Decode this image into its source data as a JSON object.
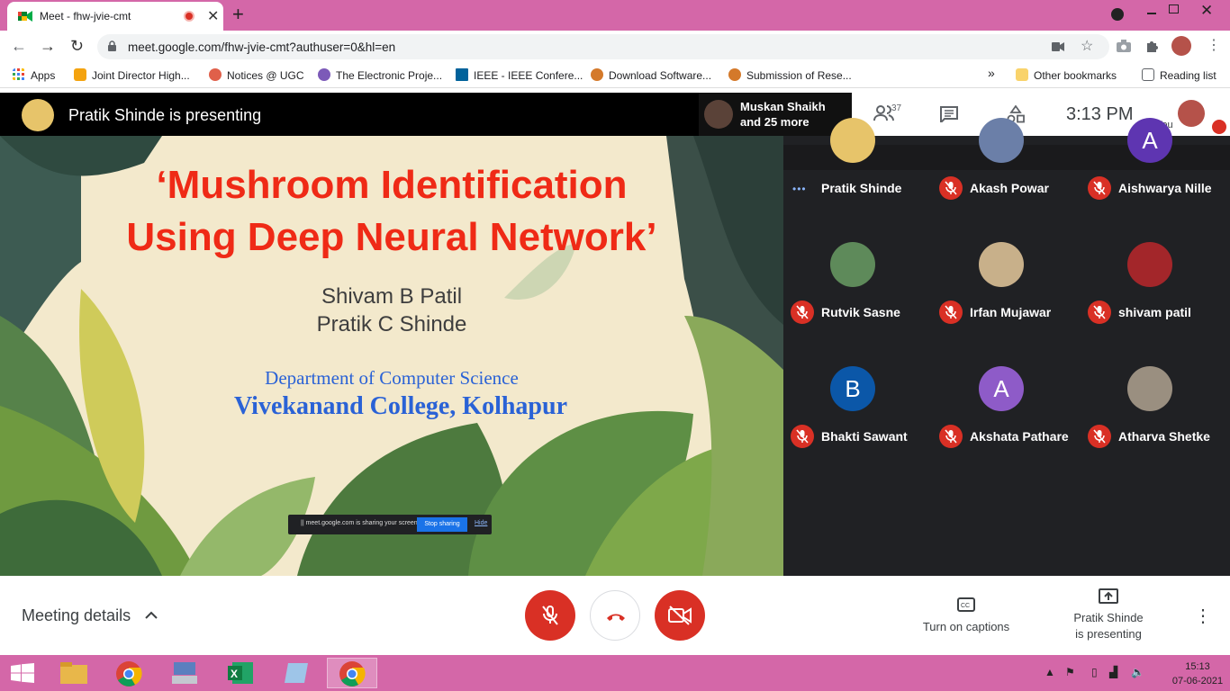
{
  "browser": {
    "tab_title": "Meet - fhw-jvie-cmt",
    "tab_close": "✕",
    "new_tab": "+",
    "url": "meet.google.com/fhw-jvie-cmt?authuser=0&hl=en"
  },
  "bookmarks": {
    "items": [
      {
        "label": "Apps",
        "color": "#4285f4"
      },
      {
        "label": "Joint Director High...",
        "color": "#f4a30f"
      },
      {
        "label": "Notices @ UGC",
        "color": "#e0604a"
      },
      {
        "label": "The Electronic Proje...",
        "color": "#7c5ab8"
      },
      {
        "label": "IEEE - IEEE Confere...",
        "color": "#00629b"
      },
      {
        "label": "Download Software...",
        "color": "#d4792a"
      },
      {
        "label": "Submission of Rese...",
        "color": "#d4792a"
      }
    ],
    "more": "»",
    "other": "Other bookmarks",
    "reading_list": "Reading list"
  },
  "meet": {
    "presenting_banner": "Pratik Shinde is presenting",
    "muskan": {
      "name": "Muskan Shaikh",
      "more": "and 25 more"
    },
    "participant_count": "37",
    "time": "3:13  PM",
    "you_label": "You"
  },
  "slide": {
    "title_line1": "‘Mushroom Identification",
    "title_line2": "Using Deep Neural Network’",
    "author1": "Shivam B Patil",
    "author2": "Pratik C Shinde",
    "department": "Department of Computer Science",
    "college": "Vivekanand College, Kolhapur",
    "share_text": "||  meet.google.com is sharing your screen.",
    "stop_sharing": "Stop sharing",
    "hide": "Hide"
  },
  "participants": [
    {
      "name": "Pratik Shinde",
      "initial": "",
      "color": "#e7c46a",
      "muted": false
    },
    {
      "name": "Akash Powar",
      "initial": "",
      "color": "#6b7fa8",
      "muted": true
    },
    {
      "name": "Aishwarya Nille",
      "initial": "A",
      "color": "#5e35b1",
      "muted": true
    },
    {
      "name": "Rutvik Sasne",
      "initial": "",
      "color": "#5e8a5a",
      "muted": true
    },
    {
      "name": "Irfan Mujawar",
      "initial": "",
      "color": "#c8b08a",
      "muted": true
    },
    {
      "name": "shivam patil",
      "initial": "",
      "color": "#a3262a",
      "muted": true
    },
    {
      "name": "Bhakti Sawant",
      "initial": "B",
      "color": "#0b57a8",
      "muted": true
    },
    {
      "name": "Akshata Pathare",
      "initial": "A",
      "color": "#8e5bc8",
      "muted": true
    },
    {
      "name": "Atharva Shetke",
      "initial": "",
      "color": "#9a8f80",
      "muted": true
    }
  ],
  "bottom": {
    "meeting_details": "Meeting details",
    "captions": "Turn on captions",
    "presenting_line1": "Pratik Shinde",
    "presenting_line2": "is presenting"
  },
  "taskbar": {
    "time": "15:13",
    "date": "07-06-2021"
  }
}
